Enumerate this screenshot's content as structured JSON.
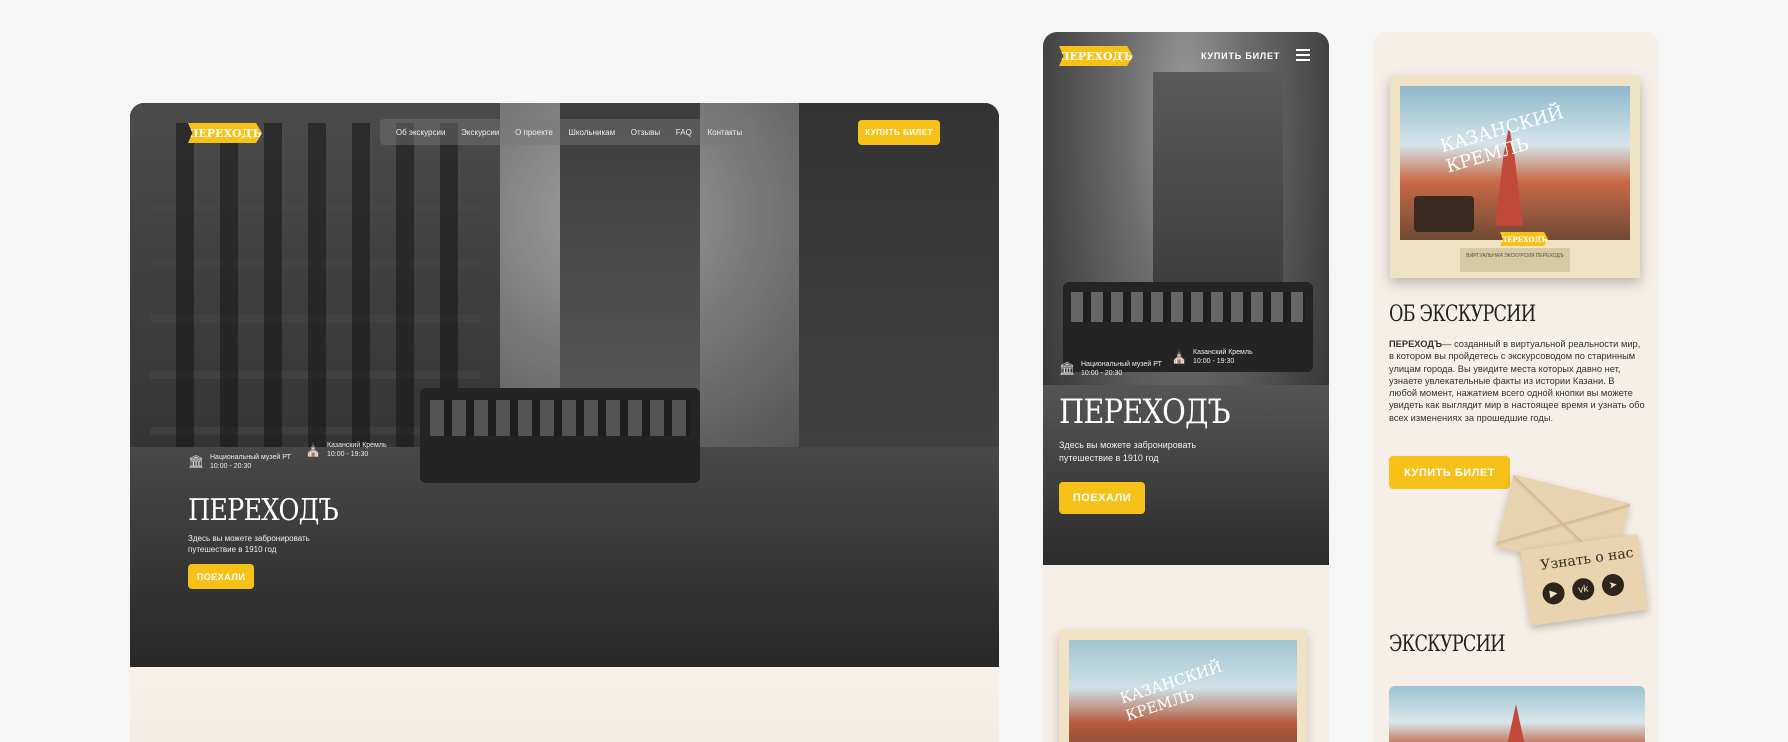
{
  "brand": {
    "logo_text": "ПЕРЕХОДЪ",
    "accent": "#f6c21a"
  },
  "desktop": {
    "nav": [
      "Об экскурсии",
      "Экскурсии",
      "О проекте",
      "Школьникам",
      "Отзывы",
      "FAQ",
      "Контакты"
    ],
    "buy_label": "КУПИТЬ БИЛЕТ",
    "venue1": {
      "name": "Национальный музей РТ",
      "hours": "10:00 - 20:30",
      "icon": "museum-icon"
    },
    "venue2": {
      "name": "Казанский Кремль",
      "hours": "10:00 - 19:30",
      "icon": "kremlin-icon"
    },
    "title": "ПЕРЕХОДЪ",
    "subtitle": "Здесь вы можете забронировать путешествие в 1910 год",
    "go_label": "ПОЕХАЛИ"
  },
  "mobile": {
    "buy_label": "КУПИТЬ БИЛЕТ",
    "venue1": {
      "name": "Национальный музей РТ",
      "hours": "10:00 - 20:30"
    },
    "venue2": {
      "name": "Казанский Кремль",
      "hours": "10:00 - 19:30"
    },
    "title": "ПЕРЕХОДЪ",
    "subtitle": "Здесь вы можете забронировать путешествие в 1910 год",
    "go_label": "ПОЕХАЛИ",
    "postcard_caption": "КАЗАНСКИЙ КРЕМЛЬ"
  },
  "panel": {
    "postcard_caption": "КАЗАНСКИЙ КРЕМЛЬ",
    "postcard_logo": "ПЕРЕХОДЪ",
    "postcard_label": "ВИРТУАЛЬНАЯ ЭКСКУРСИЯ ПЕРЕХОДЪ",
    "about_title": "ОБ ЭКСКУРСИИ",
    "about_brand": "ПЕРЕХОДЪ",
    "about_text": "— созданный в виртуальной реальности мир, в котором вы пройдетесь с экскурсоводом по старинным улицам города. Вы увидите  места которых давно нет, узнаете увлекательные факты из истории Казани. В любой момент, нажатием всего одной кнопки вы можете увидеть как выглядит мир в настоящее время и узнать обо всех изменениях за прошедшие годы.",
    "buy_label": "КУПИТЬ БИЛЕТ",
    "contact_title": "Узнать о нас",
    "socials": [
      "youtube-icon",
      "vk-icon",
      "telegram-icon"
    ],
    "tours_title": "ЭКСКУРСИИ"
  }
}
